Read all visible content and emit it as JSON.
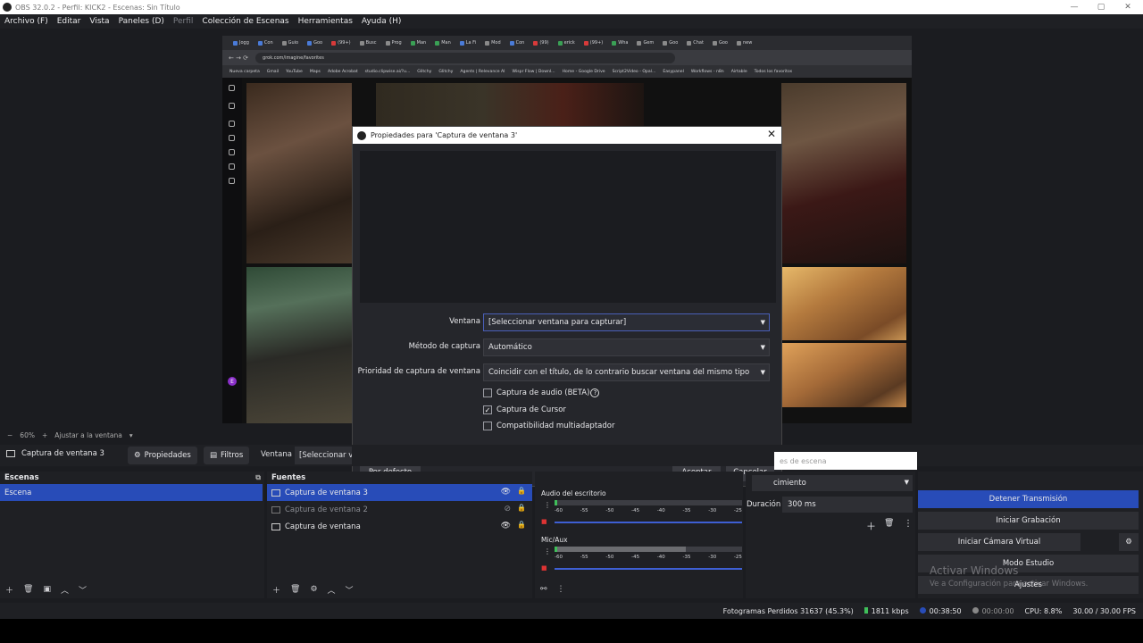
{
  "window": {
    "title": "OBS 32.0.2 - Perfil: KICK2 - Escenas: Sin Título",
    "controls": [
      "—",
      "▢",
      "✕"
    ]
  },
  "menu": [
    "Archivo (F)",
    "Editar",
    "Vista",
    "Paneles (D)",
    "Perfil",
    "Colección de Escenas",
    "Herramientas",
    "Ayuda (H)"
  ],
  "browser": {
    "tabs": [
      "Jogg",
      "Con",
      "Guio",
      "Goo",
      "(99+)",
      "Busc",
      "Prog",
      "Man",
      "Man",
      "La Fi",
      "Mod",
      "Con",
      "(99)",
      "erick",
      "(99+)",
      "Wha",
      "Gem",
      "Goo",
      "Chat",
      "Goo",
      "new"
    ],
    "url": "grok.com/imagine/favorites",
    "bookmarks": [
      "Nueva carpeta",
      "Gmail",
      "YouTube",
      "Maps",
      "Adobe Acrobat",
      "studio.clipwise.ai/?u...",
      "Glitchy",
      "Glitchy",
      "Agents | Relevance AI",
      "Wispr Flow | Downl...",
      "Home - Google Drive",
      "Script2Video - Opal...",
      "Easypanel",
      "Workflows - n8n",
      "Airtable",
      "Todos los favoritos"
    ],
    "avatar_letter": "E"
  },
  "dialog": {
    "title": "Propiedades para 'Captura de ventana 3'",
    "close": "✕",
    "fields": [
      {
        "label": "Ventana",
        "value": "[Seleccionar ventana para capturar]"
      },
      {
        "label": "Método de captura",
        "value": "Automático"
      },
      {
        "label": "Prioridad de captura de ventana",
        "value": "Coincidir con el título, de lo contrario buscar ventana del mismo tipo"
      }
    ],
    "checkboxes": [
      {
        "label": "Captura de audio (BETA)",
        "checked": false,
        "help": "?"
      },
      {
        "label": "Captura de Cursor",
        "checked": true
      },
      {
        "label": "Compatibilidad multiadaptador",
        "checked": false
      }
    ],
    "defaults_button": "Por defecto",
    "accept_button": "Aceptar",
    "cancel_button": "Cancelar"
  },
  "preview_bar": {
    "minus": "−",
    "zoom": "60%",
    "plus": "+",
    "fit": "Ajustar a la ventana"
  },
  "source_bar": {
    "source_name": "Captura de ventana 3",
    "properties": "Propiedades",
    "filters": "Filtros",
    "window_label": "Ventana",
    "window_value": "[Seleccionar ventana para capturar]"
  },
  "scene_search_placeholder": "es de escena",
  "scenes": {
    "title": "Escenas",
    "items": [
      "Escena"
    ]
  },
  "sources": {
    "title": "Fuentes",
    "items": [
      {
        "name": "Captura de ventana 3",
        "visible": true,
        "selected": true
      },
      {
        "name": "Captura de ventana 2",
        "visible": false,
        "selected": false
      },
      {
        "name": "Captura de ventana",
        "visible": true,
        "selected": false
      }
    ]
  },
  "mixer": {
    "channels": [
      {
        "name": "Audio del escritorio",
        "level": 0.02
      },
      {
        "name": "Mic/Aux",
        "level": 0.7
      }
    ],
    "ticks": [
      "-60",
      "-55",
      "-50",
      "-45",
      "-40",
      "-35",
      "-30",
      "-25"
    ]
  },
  "transitions": {
    "selected": "cimiento",
    "duration_label": "Duración",
    "duration_value": "300 ms"
  },
  "controls": {
    "stop_stream": "Detener Transmisión",
    "start_recording": "Iniciar Grabación",
    "virtual_cam": "Iniciar Cámara Virtual",
    "studio_mode": "Modo Estudio",
    "settings": "Ajustes"
  },
  "watermark": {
    "line1": "Activar Windows",
    "line2": "Ve a Configuración para activar Windows."
  },
  "status": {
    "dropped": "Fotogramas Perdidos 31637 (45.3%)",
    "bitrate": "1811 kbps",
    "stream_time": "00:38:50",
    "rec_time": "00:00:00",
    "cpu": "CPU: 8.8%",
    "fps": "30.00 / 30.00 FPS"
  },
  "colors": {
    "accent": "#284cb8",
    "panel": "#1f2024",
    "background": "#1b1c20"
  }
}
